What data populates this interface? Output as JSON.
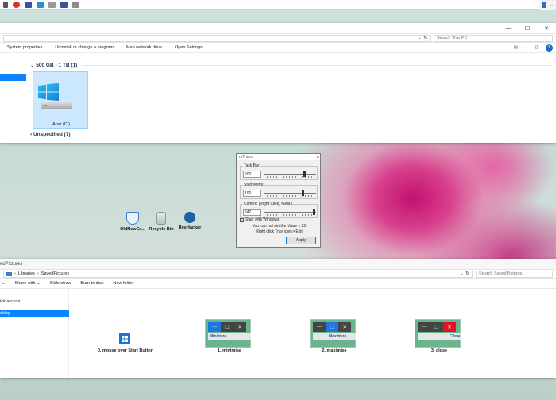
{
  "explorer1": {
    "search_placeholder": "Search This PC",
    "commands": [
      "System properties",
      "Uninstall or change a program",
      "Map network drive",
      "Open Settings"
    ],
    "group1_header": "500 GB - 1 TB (1)",
    "drive_label": "Acer (C:)",
    "group2_header": "Unspecified (7)",
    "help_glyph": "?"
  },
  "desktop_icons": [
    {
      "label": "OldNewEx..."
    },
    {
      "label": "Recycle Bin"
    },
    {
      "label": "ResHacker"
    }
  ],
  "mtrans": {
    "title": "mTrans",
    "taskbar": {
      "legend": "Task Bar",
      "value": "200",
      "level": 200
    },
    "startmenu": {
      "legend": "Start Menu",
      "value": "190",
      "level": 190
    },
    "context": {
      "legend": "Context (Right Click) Menu",
      "value": "247",
      "level": 247
    },
    "start_with_windows": "Start with Windows",
    "note1": "You can not set the Value < 25",
    "note2": "Right click Tray icon > Exit",
    "apply": "Apply"
  },
  "explorer2": {
    "title": "edPictures",
    "breadcrumb": [
      "Libraries",
      "SavedPictures"
    ],
    "search_placeholder": "Search SavedPictures",
    "commands": [
      "Share with",
      "Slide show",
      "Burn to disc",
      "New folder"
    ],
    "nav_items": [
      "ick access",
      "sktop"
    ],
    "items": [
      {
        "caption": "0. mouse over Start Button"
      },
      {
        "caption": "1. minimise",
        "tip": "Minimize"
      },
      {
        "caption": "2. maximise",
        "tip": "Maximize"
      },
      {
        "caption": "3. close",
        "tip": "Close"
      }
    ]
  },
  "colors": {
    "selection": "#0a84ff",
    "close_red": "#e81123"
  }
}
